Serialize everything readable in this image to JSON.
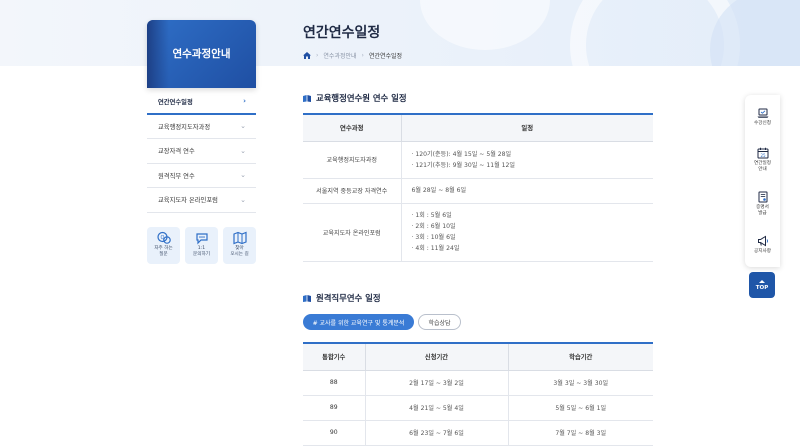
{
  "header": {
    "page_title": "연간연수일정",
    "breadcrumb": [
      "연수과정안내",
      "연간연수일정"
    ]
  },
  "sidebar": {
    "title": "연수과정안내",
    "items": [
      {
        "label": "연간연수일정",
        "active": true
      },
      {
        "label": "교육행정지도자과정"
      },
      {
        "label": "교장자격 연수"
      },
      {
        "label": "원격직무 연수"
      },
      {
        "label": "교육지도자 온라인포럼"
      }
    ],
    "quick": [
      {
        "label": "자주 하는\n질문",
        "icon": "faq-icon"
      },
      {
        "label": "1:1\n문의하기",
        "icon": "chat-icon"
      },
      {
        "label": "찾아\n오시는 길",
        "icon": "map-icon"
      }
    ]
  },
  "section1": {
    "title": "교육행정연수원 연수 일정",
    "headers": [
      "연수과정",
      "일정"
    ],
    "rows": [
      {
        "course": "교육행정지도자과정",
        "schedule": [
          "· 120기(춘등): 4월 15일 ~ 5월 28일",
          "· 121기(추등): 9월 30일 ~ 11월 12일"
        ]
      },
      {
        "course": "서울지역 중등교장 자격연수",
        "schedule": [
          "6월 28일 ~ 8월 6일"
        ]
      },
      {
        "course": "교육지도자 온라인포럼",
        "schedule": [
          "· 1회 : 5월 6일",
          "· 2회 : 6월 10일",
          "· 3회 : 10월 6일",
          "· 4회 : 11월 24일"
        ]
      }
    ]
  },
  "section2": {
    "title": "원격직무연수 일정",
    "tab_active": "# 교사를 위한 교육연구 및 통계분석",
    "tab_other": "학습상담",
    "headers": [
      "통합기수",
      "신청기간",
      "학습기간"
    ],
    "rows": [
      [
        "88",
        "2월 17일 ~ 3월 2일",
        "3월 3일 ~ 3월 30일"
      ],
      [
        "89",
        "4월 21일 ~ 5월 4일",
        "5월 5일 ~ 6월 1일"
      ],
      [
        "90",
        "6월 23일 ~ 7월 6일",
        "7월 7일 ~ 8월 3일"
      ]
    ]
  },
  "right_bar": {
    "items": [
      {
        "label": "수강신청",
        "icon": "laptop-icon"
      },
      {
        "label": "연간일정\n안내",
        "icon": "calendar-icon"
      },
      {
        "label": "증명서\n발급",
        "icon": "certificate-icon"
      },
      {
        "label": "공지사항",
        "icon": "megaphone-icon"
      }
    ],
    "top_label": "TOP"
  },
  "colors": {
    "accent": "#2f6fc7",
    "brand_dark": "#1f56a8",
    "tab_active": "#3a7bd5"
  }
}
